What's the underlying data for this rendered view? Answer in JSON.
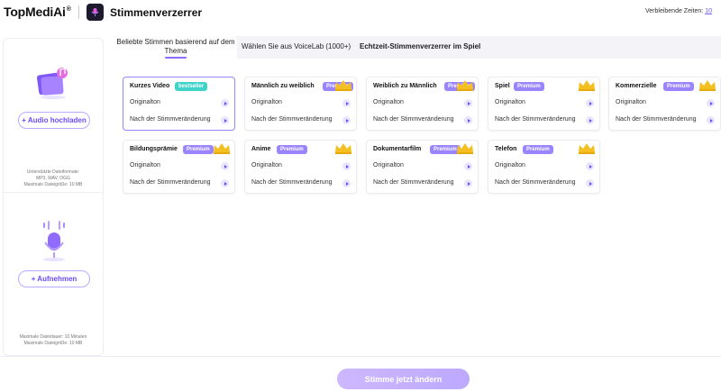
{
  "header": {
    "brand": "TopMediAi",
    "brand_sup": "®",
    "app_title": "Stimmenverzerrer",
    "remaining_time_label": "Verbleibende Zeiten:",
    "remaining_time_value": "10"
  },
  "sidebar": {
    "upload_button": "+ Audio hochladen",
    "upload_note": [
      "Unterstützte Dateiformate:",
      "MP3, WAV, OGG",
      "Maximale Dateigröße: 10 MB"
    ],
    "record_button": "+ Aufnehmen",
    "record_note": [
      "Maximale Dateidauer: 10 Minuten",
      "Maximale Dateigröße: 10 MB"
    ]
  },
  "tabs": [
    {
      "label": "Beliebte Stimmen basierend auf dem Thema",
      "active": true
    },
    {
      "label": "Wählen Sie aus VoiceLab (1000+)",
      "active": false
    },
    {
      "label": "Echtzeit-Stimmenverzerrer im Spiel",
      "active": false
    }
  ],
  "cards": [
    {
      "title": "Kurzes Video",
      "badge": "bestseller",
      "badge_type": "best",
      "crown": false,
      "selected": true,
      "row1": "Originalton",
      "row2": "Nach der Stimmveränderung"
    },
    {
      "title": "Männlich zu weiblich",
      "badge": "Premium",
      "badge_type": "prem",
      "crown": true,
      "selected": false,
      "row1": "Originalton",
      "row2": "Nach der Stimmveränderung"
    },
    {
      "title": "Weiblich zu Männlich",
      "badge": "Premium",
      "badge_type": "prem",
      "crown": true,
      "selected": false,
      "row1": "Originalton",
      "row2": "Nach der Stimmveränderung"
    },
    {
      "title": "Spiel",
      "badge": "Premium",
      "badge_type": "prem",
      "crown": true,
      "selected": false,
      "row1": "Originalton",
      "row2": "Nach der Stimmveränderung"
    },
    {
      "title": "Kommerzielle",
      "badge": "Premium",
      "badge_type": "prem",
      "crown": true,
      "selected": false,
      "row1": "Originalton",
      "row2": "Nach der Stimmveränderung"
    },
    {
      "title": "Bildungsprämie",
      "badge": "Premium",
      "badge_type": "prem",
      "crown": true,
      "selected": false,
      "row1": "Originalton",
      "row2": "Nach der Stimmveränderung"
    },
    {
      "title": "Anime",
      "badge": "Premium",
      "badge_type": "prem",
      "crown": true,
      "selected": false,
      "row1": "Originalton",
      "row2": "Nach der Stimmveränderung"
    },
    {
      "title": "Dokumentarfilm",
      "badge": "Premium",
      "badge_type": "prem",
      "crown": true,
      "selected": false,
      "row1": "Originalton",
      "row2": "Nach der Stimmveränderung"
    },
    {
      "title": "Telefon",
      "badge": "Premium",
      "badge_type": "prem",
      "crown": true,
      "selected": false,
      "row1": "Originalton",
      "row2": "Nach der Stimmveränderung"
    }
  ],
  "footer": {
    "primary_button": "Stimme jetzt ändern"
  },
  "colors": {
    "accent": "#8b6bff",
    "bestseller": "#3fd3c9",
    "premium": "#9b85ff",
    "crown": "#f4c021"
  }
}
